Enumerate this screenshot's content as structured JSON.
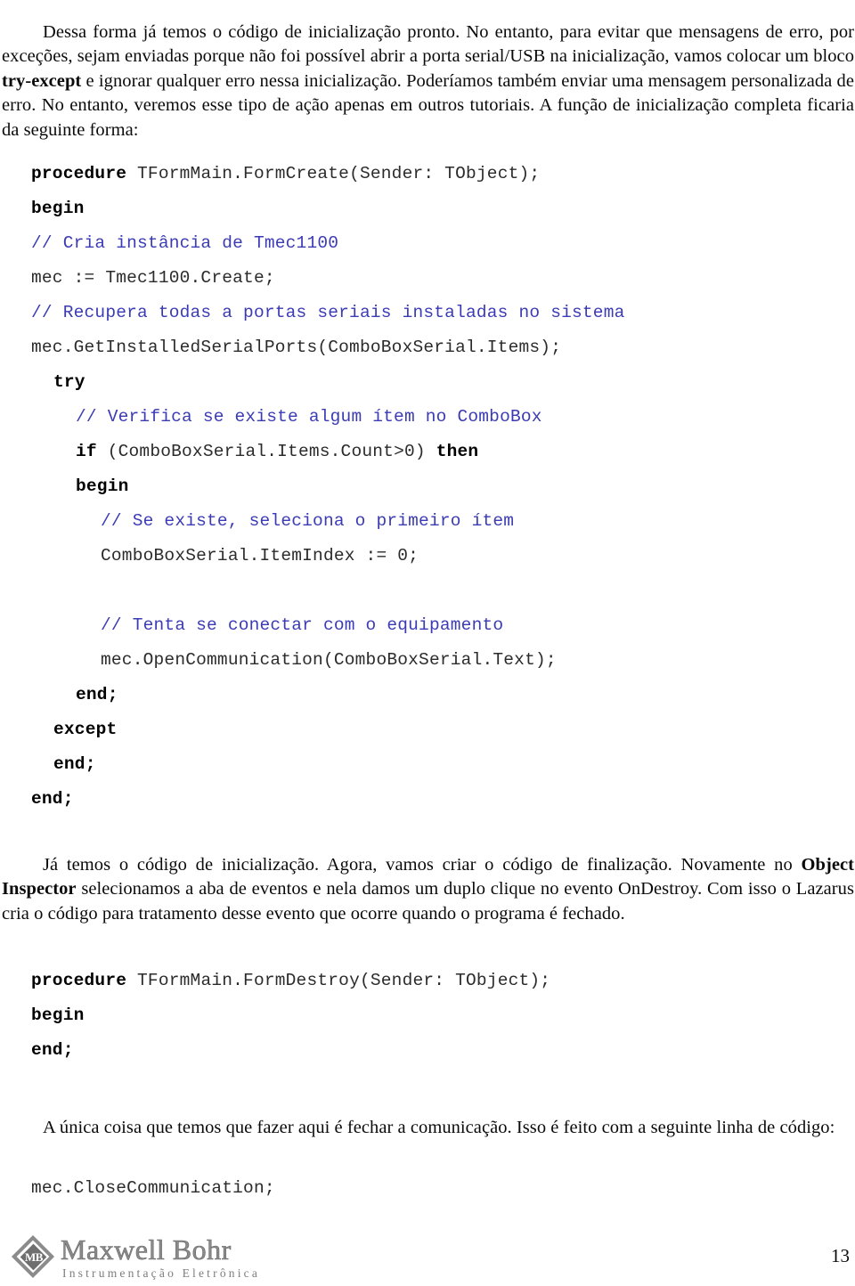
{
  "document": {
    "page_number": "13",
    "paragraphs": {
      "intro_part1": "Dessa forma já temos o código de inicialização pronto. No entanto, para evitar que mensagens de erro, por exceções, sejam enviadas porque não foi possível abrir a porta serial/USB na inicialização, vamos colocar um bloco ",
      "intro_bold": "try-except",
      "intro_part2": " e ignorar qualquer erro nessa inicialização. Poderíamos também enviar uma mensagem personalizada de erro. No entanto, veremos esse tipo de ação apenas em outros tutoriais. A função de inicialização completa ficaria da seguinte forma:",
      "middle_part1": "Já temos o código de inicialização. Agora, vamos criar o código de finalização. Novamente no ",
      "middle_bold": "Object Inspector",
      "middle_part2": " selecionamos a aba de eventos e nela damos um duplo clique no evento OnDestroy. Com isso o Lazarus cria o código para tratamento desse evento que ocorre quando o programa é fechado.",
      "final_text": "A única coisa que temos que fazer aqui é fechar a comunicação. Isso é feito com a seguinte linha de código:"
    },
    "code_blocks": {
      "form_create": {
        "lines": [
          {
            "indent": 0,
            "parts": [
              {
                "style": "kw",
                "text": "procedure "
              },
              {
                "style": "pln",
                "text": "TFormMain.FormCreate(Sender: TObject);"
              }
            ]
          },
          {
            "indent": 0,
            "parts": [
              {
                "style": "kw",
                "text": "begin"
              }
            ]
          },
          {
            "indent": 0,
            "parts": [
              {
                "style": "cmt",
                "text": "// Cria instância de Tmec1100"
              }
            ]
          },
          {
            "indent": 0,
            "parts": [
              {
                "style": "pln",
                "text": "mec := Tmec1100.Create;"
              }
            ]
          },
          {
            "indent": 0,
            "parts": [
              {
                "style": "cmt",
                "text": "// Recupera todas a portas seriais instaladas no sistema"
              }
            ]
          },
          {
            "indent": 0,
            "parts": [
              {
                "style": "pln",
                "text": "mec.GetInstalledSerialPorts(ComboBoxSerial.Items);"
              }
            ]
          },
          {
            "indent": 1,
            "parts": [
              {
                "style": "kw",
                "text": "try"
              }
            ]
          },
          {
            "indent": 2,
            "parts": [
              {
                "style": "cmt",
                "text": "// Verifica se existe algum ítem no ComboBox"
              }
            ]
          },
          {
            "indent": 2,
            "parts": [
              {
                "style": "kw",
                "text": "if "
              },
              {
                "style": "pln",
                "text": "(ComboBoxSerial.Items.Count>0) "
              },
              {
                "style": "kw",
                "text": "then"
              }
            ]
          },
          {
            "indent": 2,
            "parts": [
              {
                "style": "kw",
                "text": "begin"
              }
            ]
          },
          {
            "indent": 3,
            "parts": [
              {
                "style": "cmt",
                "text": "// Se existe, seleciona o primeiro ítem"
              }
            ]
          },
          {
            "indent": 3,
            "parts": [
              {
                "style": "pln",
                "text": "ComboBoxSerial.ItemIndex := 0;"
              }
            ]
          },
          {
            "indent": 0,
            "blank": true,
            "parts": []
          },
          {
            "indent": 3,
            "parts": [
              {
                "style": "cmt",
                "text": "// Tenta se conectar com o equipamento"
              }
            ]
          },
          {
            "indent": 3,
            "parts": [
              {
                "style": "pln",
                "text": "mec.OpenCommunication(ComboBoxSerial.Text);"
              }
            ]
          },
          {
            "indent": 2,
            "parts": [
              {
                "style": "kw",
                "text": "end;"
              }
            ]
          },
          {
            "indent": 1,
            "parts": [
              {
                "style": "kw",
                "text": "except"
              }
            ]
          },
          {
            "indent": 1,
            "parts": [
              {
                "style": "kw",
                "text": "end;"
              }
            ]
          },
          {
            "indent": 0,
            "parts": [
              {
                "style": "kw",
                "text": "end;"
              }
            ]
          }
        ]
      },
      "form_destroy": {
        "lines": [
          {
            "indent": 0,
            "parts": [
              {
                "style": "kw",
                "text": "procedure "
              },
              {
                "style": "pln",
                "text": "TFormMain.FormDestroy(Sender: TObject);"
              }
            ]
          },
          {
            "indent": 0,
            "parts": [
              {
                "style": "kw",
                "text": "begin"
              }
            ]
          },
          {
            "indent": 0,
            "parts": [
              {
                "style": "kw",
                "text": "end;"
              }
            ]
          }
        ]
      },
      "close_communication": {
        "lines": [
          {
            "indent": 0,
            "parts": [
              {
                "style": "pln",
                "text": "mec.CloseCommunication;"
              }
            ]
          }
        ]
      }
    },
    "footer": {
      "logo_monogram": "MB",
      "logo_name": "Maxwell Bohr",
      "logo_tagline": "Instrumentação Eletrônica"
    },
    "colors": {
      "comment": "#3b3bb5",
      "keyword": "#000000",
      "code_plain": "#2b2b2b",
      "body_text": "#0a0a0a",
      "logo_gray": "#8a8a8a"
    }
  }
}
